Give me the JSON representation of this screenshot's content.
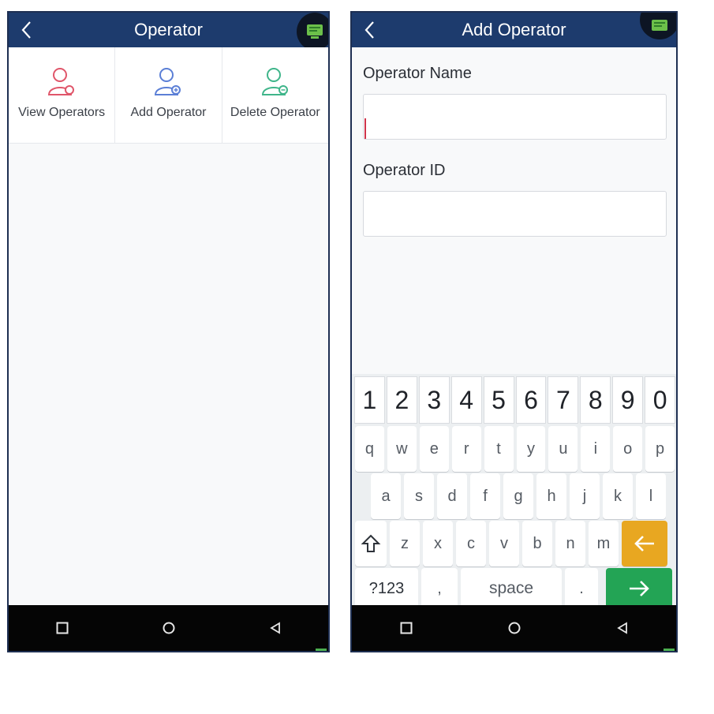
{
  "left_screen": {
    "title": "Operator",
    "menu": [
      {
        "label": "View Operators",
        "icon": "user-view-icon",
        "color": "#e0566a"
      },
      {
        "label": "Add Operator",
        "icon": "user-add-icon",
        "color": "#5b7fd6"
      },
      {
        "label": "Delete Operator",
        "icon": "user-delete-icon",
        "color": "#3fb58a"
      }
    ]
  },
  "right_screen": {
    "title": "Add Operator",
    "fields": [
      {
        "label": "Operator Name",
        "value": ""
      },
      {
        "label": "Operator ID",
        "value": ""
      }
    ],
    "keyboard": {
      "numbers": [
        "1",
        "2",
        "3",
        "4",
        "5",
        "6",
        "7",
        "8",
        "9",
        "0"
      ],
      "row1": [
        "q",
        "w",
        "e",
        "r",
        "t",
        "y",
        "u",
        "i",
        "o",
        "p"
      ],
      "row2": [
        "a",
        "s",
        "d",
        "f",
        "g",
        "h",
        "j",
        "k",
        "l"
      ],
      "row3": [
        "z",
        "x",
        "c",
        "v",
        "b",
        "n",
        "m"
      ],
      "symbols_key": "?123",
      "comma_key": ",",
      "space_key": "space",
      "period_key": "."
    }
  },
  "colors": {
    "appbar": "#1d3b6d",
    "navbar": "#050505",
    "backspace": "#e8a721",
    "enter": "#23a455"
  }
}
